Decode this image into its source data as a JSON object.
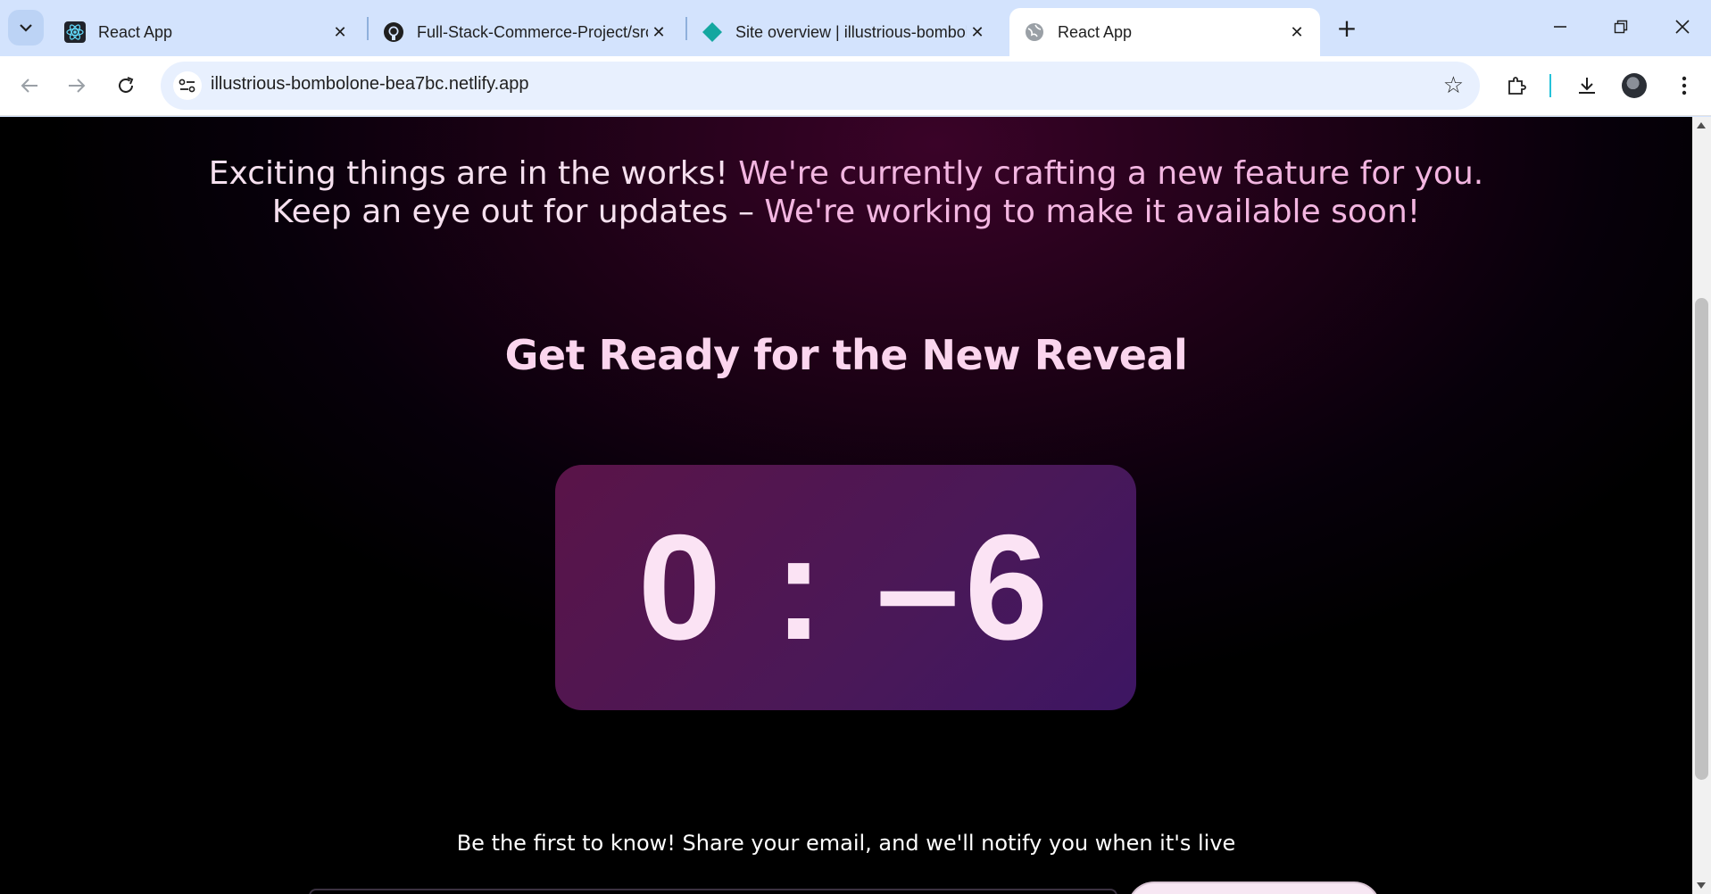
{
  "browser": {
    "tabs": [
      {
        "title": "React App",
        "icon": "react-icon",
        "active": false
      },
      {
        "title": "Full-Stack-Commerce-Project/src",
        "icon": "github-icon",
        "active": false
      },
      {
        "title": "Site overview | illustrious-bombolone",
        "icon": "netlify-icon",
        "active": false
      },
      {
        "title": "React App",
        "icon": "globe-icon",
        "active": true
      }
    ],
    "new_tab_label": "+",
    "url": "illustrious-bombolone-bea7bc.netlify.app",
    "accent_color": "#d3e3fd"
  },
  "page": {
    "intro_line1_a": "Exciting things are in the works! ",
    "intro_line1_b": "We're currently crafting a new feature for you.",
    "intro_line2_a": "Keep an eye out for updates – ",
    "intro_line2_b": "We're working to make it available soon!",
    "headline": "Get Ready for the New Reveal",
    "countdown": "0 : –6",
    "notify_text": "Be the first to know! Share your email, and we'll notify you when it's live",
    "colors": {
      "countdown_box": "#4a1858",
      "headline": "#fbd5ee",
      "accent_pink": "#f3b6e1"
    }
  }
}
